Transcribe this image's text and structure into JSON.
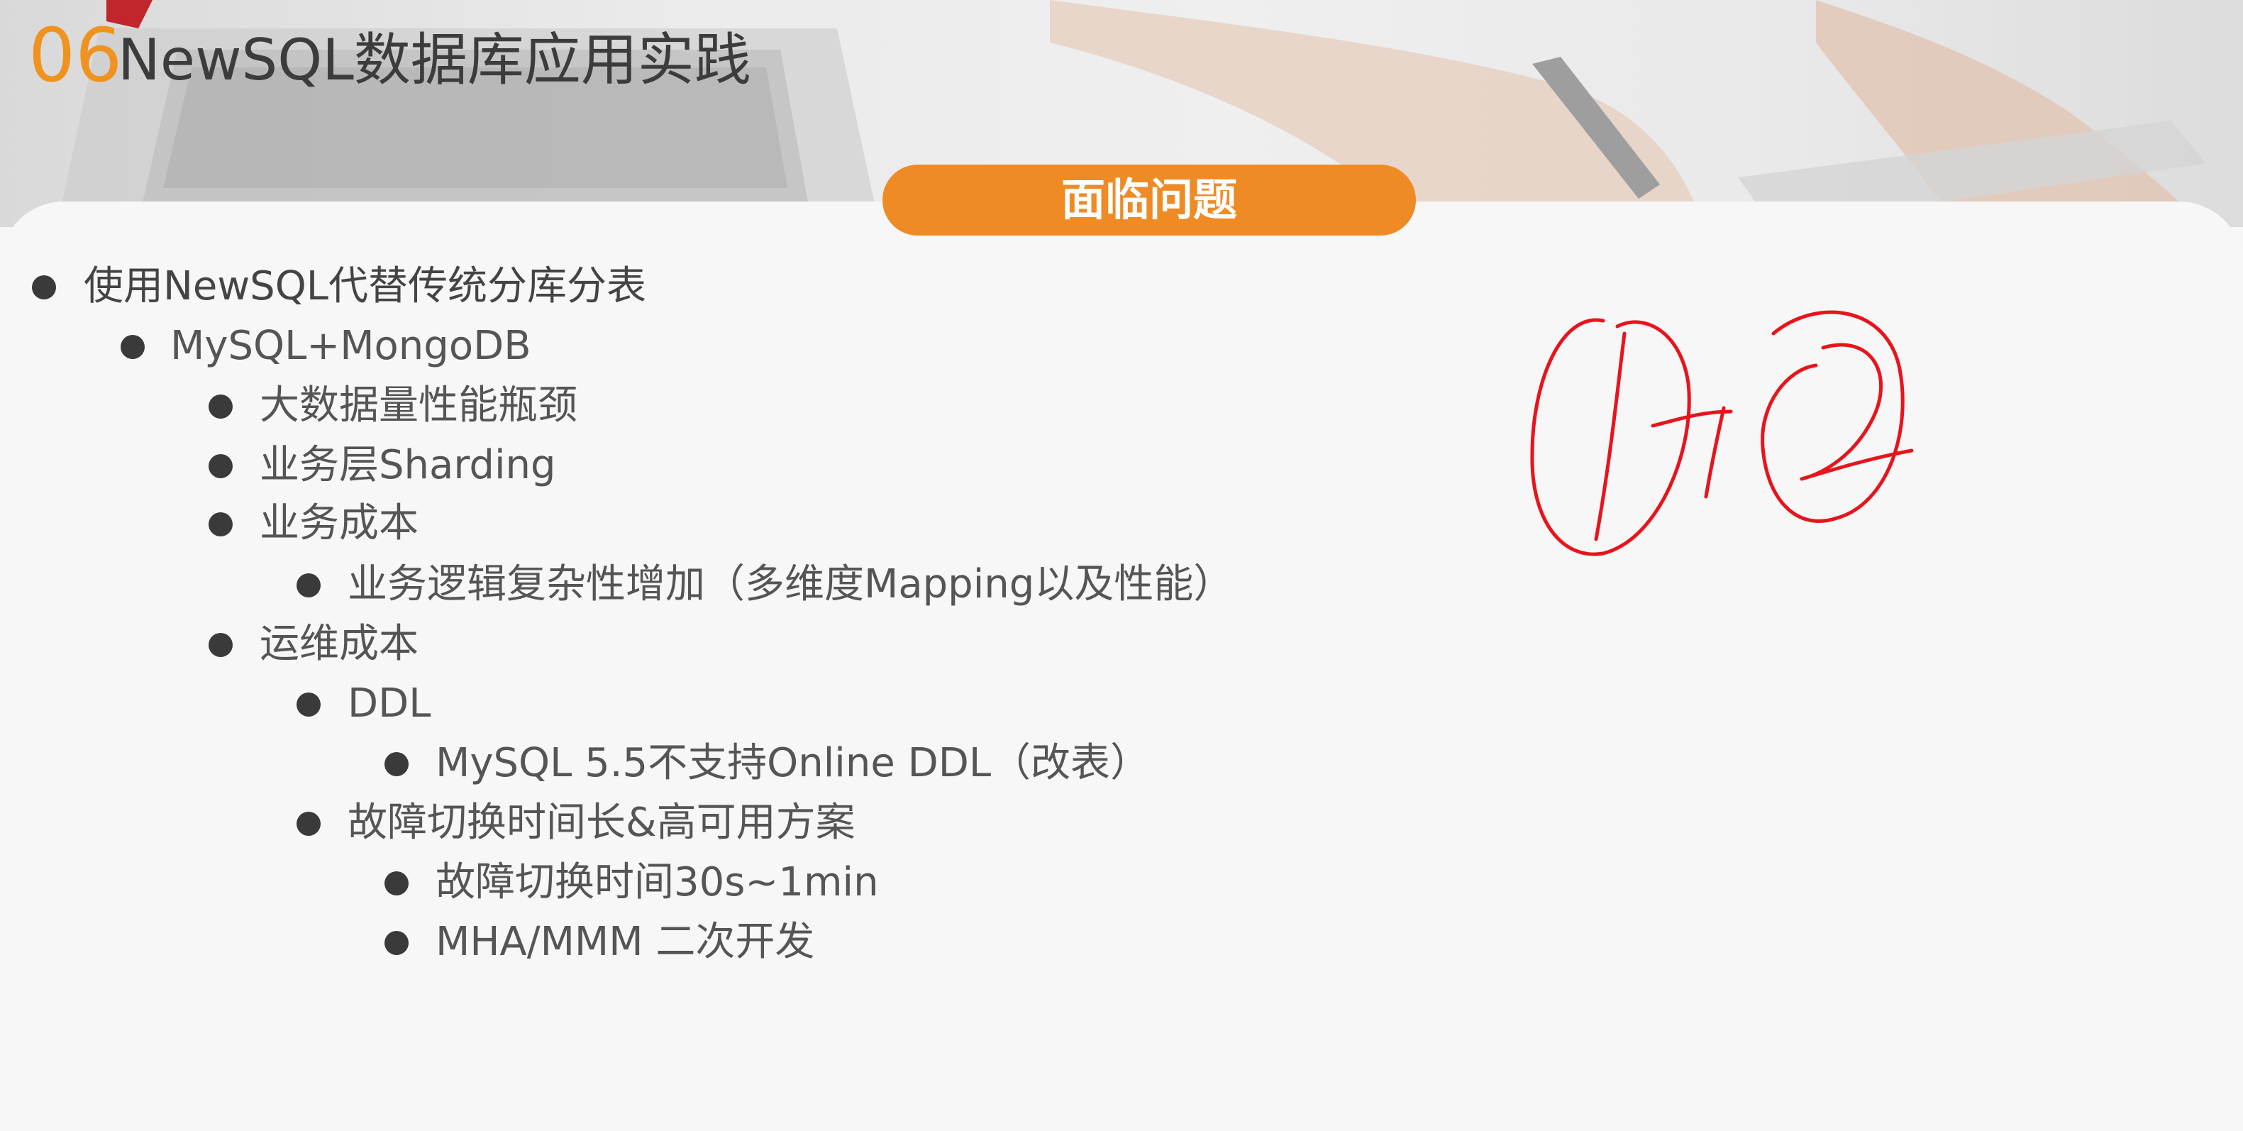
{
  "header": {
    "section_number": "06",
    "section_title": "NewSQL数据库应用实践"
  },
  "heading": "面临问题",
  "outline": [
    {
      "level": 0,
      "text": "使用NewSQL代替传统分库分表"
    },
    {
      "level": 1,
      "text": "MySQL+MongoDB"
    },
    {
      "level": 2,
      "text": "大数据量性能瓶颈"
    },
    {
      "level": 2,
      "text": "业务层Sharding"
    },
    {
      "level": 2,
      "text": "业务成本"
    },
    {
      "level": 3,
      "text": "业务逻辑复杂性增加（多维度Mapping以及性能）"
    },
    {
      "level": 2,
      "text": "运维成本"
    },
    {
      "level": 3,
      "text": "DDL"
    },
    {
      "level": 4,
      "text": "MySQL 5.5不支持Online DDL（改表）"
    },
    {
      "level": 3,
      "text": "故障切换时间长&高可用方案"
    },
    {
      "level": 4,
      "text": "故障切换时间30s~1min"
    },
    {
      "level": 4,
      "text": "MHA/MMM  二次开发"
    }
  ],
  "annotation": {
    "color": "#e8141c",
    "description_icon": "handwritten-0-arrow-2-icon"
  }
}
